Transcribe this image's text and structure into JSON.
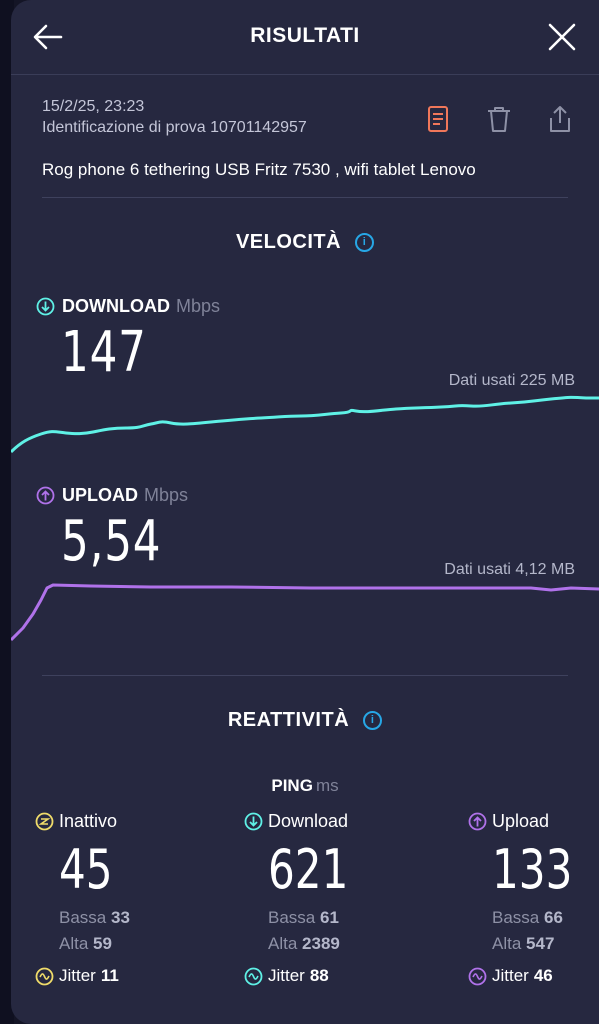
{
  "header": {
    "title": "RISULTATI"
  },
  "meta": {
    "date": "15/2/25, 23:23",
    "test_id": "Identificazione di prova 10701142957",
    "description": "Rog phone 6 tethering USB Fritz 7530 , wifi tablet Lenovo"
  },
  "speed": {
    "section_title": "VELOCITÀ",
    "download": {
      "label": "DOWNLOAD",
      "unit": "Mbps",
      "value": "147",
      "data_used": "Dati usati 225 MB",
      "color": "#5ff1e6"
    },
    "upload": {
      "label": "UPLOAD",
      "unit": "Mbps",
      "value": "5,54",
      "data_used": "Dati usati 4,12 MB",
      "color": "#b072ea"
    }
  },
  "responsiveness": {
    "section_title": "REATTIVITÀ",
    "ping_label": "PING",
    "ping_unit": "ms",
    "columns": [
      {
        "name": "Inattivo",
        "value": "45",
        "low_label": "Bassa",
        "low": "33",
        "high_label": "Alta",
        "high": "59",
        "jitter_label": "Jitter",
        "jitter": "11",
        "color": "#f0dc6a"
      },
      {
        "name": "Download",
        "value": "621",
        "low_label": "Bassa",
        "low": "61",
        "high_label": "Alta",
        "high": "2389",
        "jitter_label": "Jitter",
        "jitter": "88",
        "color": "#5ff1e6"
      },
      {
        "name": "Upload",
        "value": "133",
        "low_label": "Bassa",
        "low": "66",
        "high_label": "Alta",
        "high": "547",
        "jitter_label": "Jitter",
        "jitter": "46",
        "color": "#b072ea"
      }
    ]
  },
  "icons": [
    "back-arrow-icon",
    "close-icon",
    "document-icon",
    "trash-icon",
    "share-icon",
    "info-icon",
    "download-arrow-icon",
    "upload-arrow-icon",
    "idle-icon",
    "jitter-icon"
  ],
  "colors": {
    "accent_orange": "#f0775a",
    "info_blue": "#27a7e6",
    "panel": "#262840"
  }
}
